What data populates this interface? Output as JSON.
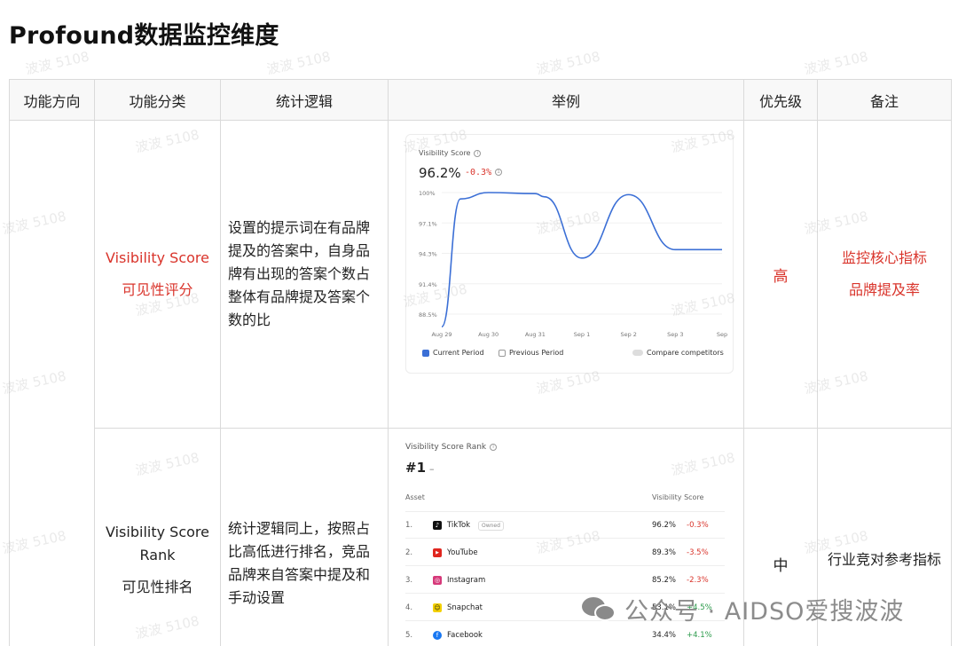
{
  "title": "Profound数据监控维度",
  "headers": [
    "功能方向",
    "功能分类",
    "统计逻辑",
    "举例",
    "优先级",
    "备注"
  ],
  "rows": [
    {
      "category_en": "Visibility Score",
      "category_cn": "可见性评分",
      "logic": "设置的提示词在有品牌提及的答案中，自身品牌有出现的答案个数占整体有品牌提及答案个数的比",
      "priority": "高",
      "note_1": "监控核心指标",
      "note_2": "品牌提及率"
    },
    {
      "category_en_1": "Visibility Score",
      "category_en_2": "Rank",
      "category_cn": "可见性排名",
      "logic": "统计逻辑同上，按照占比高低进行排名，竞品品牌来自答案中提及和手动设置",
      "priority": "中",
      "note": "行业竞对参考指标"
    }
  ],
  "score_card": {
    "label": "Visibility Score",
    "value": "96.2%",
    "delta": "-0.3%",
    "legend_current": "Current Period",
    "legend_previous": "Previous Period",
    "legend_compare": "Compare competitors"
  },
  "chart_data": {
    "type": "line",
    "categories": [
      "Aug 29",
      "Aug 30",
      "Aug 31",
      "Sep 1",
      "Sep 2",
      "Sep 3",
      "Sep"
    ],
    "y_ticks": [
      "100%",
      "97.1%",
      "94.3%",
      "91.4%",
      "88.5%"
    ],
    "ylim": [
      88.5,
      100
    ],
    "series": [
      {
        "x": [
          0,
          0.4,
          1.0,
          2.0,
          2.2,
          3.0,
          4.0,
          5.0,
          6.0
        ],
        "values": [
          87.3,
          99.4,
          100.0,
          99.9,
          99.6,
          93.8,
          99.8,
          94.6,
          94.6
        ]
      }
    ],
    "color": "#3b6fd6",
    "grid": true
  },
  "rank_card": {
    "label": "Visibility Score Rank",
    "value": "#1",
    "dash": "–",
    "col_asset": "Asset",
    "col_score": "Visibility Score",
    "rows": [
      {
        "num": "1.",
        "name": "TikTok",
        "owned": "Owned",
        "score": "96.2%",
        "change": "-0.3%",
        "icon": "tiktok-icon"
      },
      {
        "num": "2.",
        "name": "YouTube",
        "owned": "",
        "score": "89.3%",
        "change": "-3.5%",
        "icon": "youtube-icon"
      },
      {
        "num": "3.",
        "name": "Instagram",
        "owned": "",
        "score": "85.2%",
        "change": "-2.3%",
        "icon": "instagram-icon"
      },
      {
        "num": "4.",
        "name": "Snapchat",
        "owned": "",
        "score": "53.1%",
        "change": "+4.5%",
        "icon": "snapchat-icon"
      },
      {
        "num": "5.",
        "name": "Facebook",
        "owned": "",
        "score": "34.4%",
        "change": "+4.1%",
        "icon": "facebook-icon"
      }
    ]
  },
  "watermark": "波波 5108",
  "footer": "公众号 · AIDSO爱搜波波",
  "colors": {
    "accent_red": "#d9342b",
    "line_blue": "#3b6fd6",
    "positive_green": "#2a9a4a"
  }
}
